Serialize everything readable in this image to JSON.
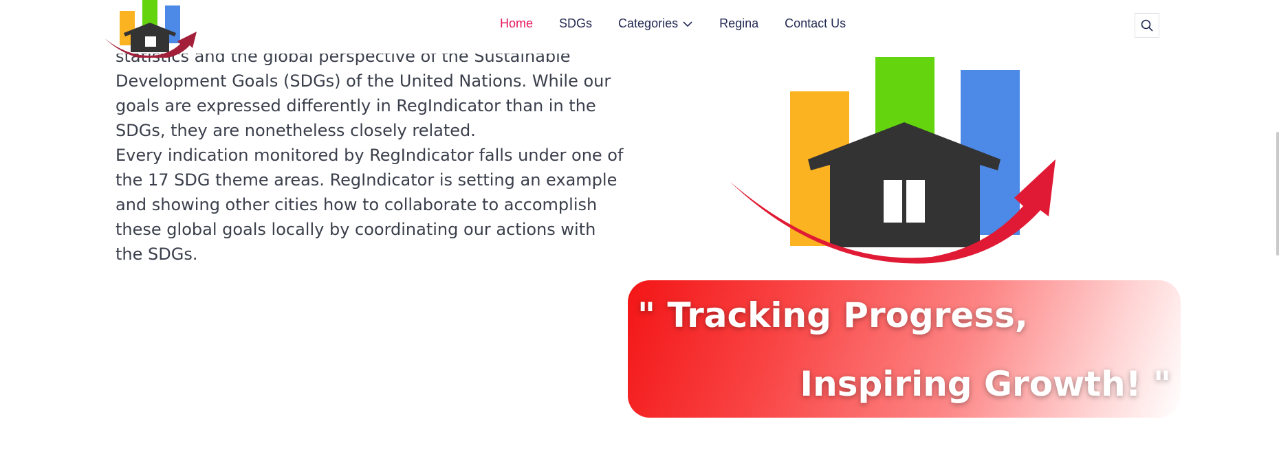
{
  "nav": {
    "items": [
      {
        "label": "Home",
        "active": true
      },
      {
        "label": "SDGs",
        "active": false
      },
      {
        "label": "Categories",
        "active": false,
        "dropdown": true
      },
      {
        "label": "Regina",
        "active": false
      },
      {
        "label": "Contact Us",
        "active": false
      }
    ],
    "search_icon": "search-icon"
  },
  "content": {
    "paragraph_1": "statistics and the global perspective of the Sustainable Development Goals (SDGs) of the United Nations. While our goals are expressed differently in RegIndicator than in the SDGs, they are nonetheless closely related.",
    "paragraph_2": "Every indication monitored by RegIndicator falls under one of the 17 SDG theme areas. RegIndicator is setting an example and showing other cities how to collaborate to accomplish these global goals locally by coordinating our actions with the SDGs."
  },
  "banner": {
    "line_1": "\" Tracking Progress,",
    "line_2": "Inspiring Growth! \""
  },
  "colors": {
    "accent": "#e6175c",
    "nav_text": "#232a52",
    "bar_orange": "#fbb321",
    "bar_green": "#63d40e",
    "bar_blue": "#4d89e6",
    "house": "#333333",
    "arrow": "#e01a34"
  }
}
